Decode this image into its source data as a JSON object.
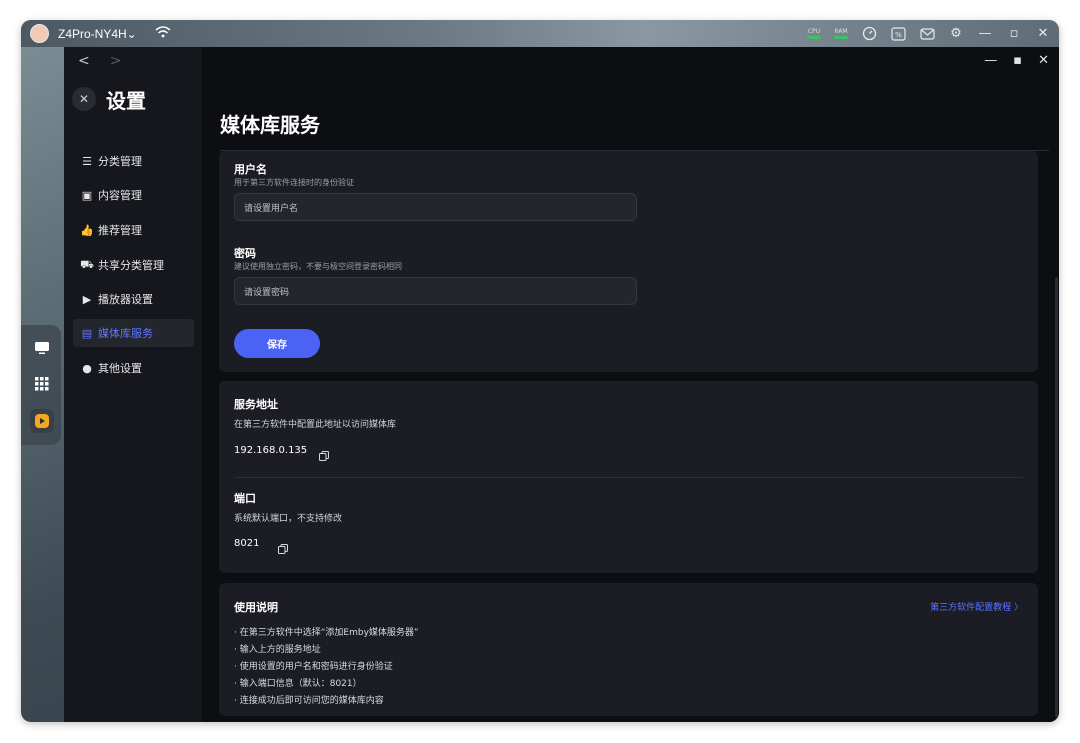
{
  "topbar": {
    "device_name": "Z4Pro-NY4H⌄",
    "cpu_label": "CPU",
    "ram_label": "RAM",
    "tray_badge": "%"
  },
  "sidebar": {
    "title": "设置",
    "items": [
      {
        "label": "分类管理",
        "icon": "list-icon"
      },
      {
        "label": "内容管理",
        "icon": "content-icon"
      },
      {
        "label": "推荐管理",
        "icon": "thumbs-up-icon"
      },
      {
        "label": "共享分类管理",
        "icon": "share-icon"
      },
      {
        "label": "播放器设置",
        "icon": "play-icon"
      },
      {
        "label": "媒体库服务",
        "icon": "media-server-icon",
        "active": true
      },
      {
        "label": "其他设置",
        "icon": "more-icon"
      }
    ]
  },
  "main": {
    "title": "媒体库服务",
    "username": {
      "label": "用户名",
      "hint": "用于第三方软件连接时的身份验证",
      "placeholder": "请设置用户名"
    },
    "password": {
      "label": "密码",
      "hint": "建议使用独立密码，不要与极空间登录密码相同",
      "placeholder": "请设置密码"
    },
    "save_label": "保存",
    "service": {
      "label": "服务地址",
      "desc": "在第三方软件中配置此地址以访问媒体库",
      "address": "192.168.0.135"
    },
    "port": {
      "label": "端口",
      "desc": "系统默认端口，不支持修改",
      "value": "8021"
    },
    "usage": {
      "title": "使用说明",
      "link": "第三方软件配置教程 〉",
      "items": [
        "在第三方软件中选择“添加Emby媒体服务器”",
        "输入上方的服务地址",
        "使用设置的用户名和密码进行身份验证",
        "输入端口信息（默认：8021）",
        "连接成功后即可访问您的媒体库内容"
      ]
    }
  },
  "colors": {
    "accent": "#4a63f5",
    "link": "#5a72ff",
    "background": "#0d0e12",
    "card": "#1c1d24"
  }
}
